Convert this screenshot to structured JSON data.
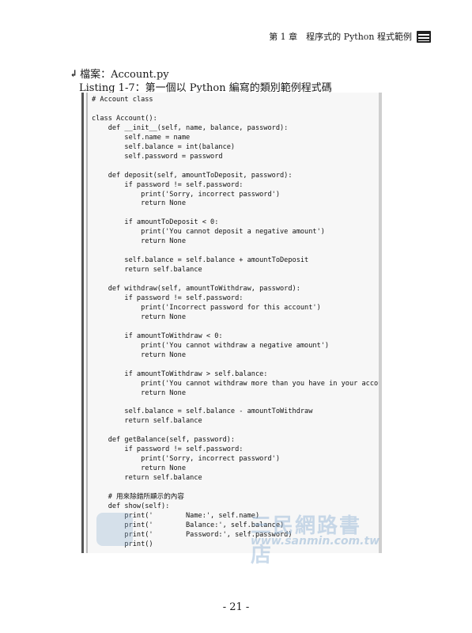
{
  "header": {
    "chapter_title": "第 1 章　程序式的 Python 程式範例",
    "icon": "book-icon"
  },
  "file_label": "檔案：Account.py",
  "listing_caption": "Listing 1-7：第一個以 Python 編寫的類別範例程式碼",
  "code": "# Account class\n\nclass Account():\n    def __init__(self, name, balance, password):\n        self.name = name\n        self.balance = int(balance)\n        self.password = password\n\n    def deposit(self, amountToDeposit, password):\n        if password != self.password:\n            print('Sorry, incorrect password')\n            return None\n\n        if amountToDeposit < 0:\n            print('You cannot deposit a negative amount')\n            return None\n\n        self.balance = self.balance + amountToDeposit\n        return self.balance\n\n    def withdraw(self, amountToWithdraw, password):\n        if password != self.password:\n            print('Incorrect password for this account')\n            return None\n\n        if amountToWithdraw < 0:\n            print('You cannot withdraw a negative amount')\n            return None\n\n        if amountToWithdraw > self.balance:\n            print('You cannot withdraw more than you have in your account')\n            return None\n\n        self.balance = self.balance - amountToWithdraw\n        return self.balance\n\n    def getBalance(self, password):\n        if password != self.password:\n            print('Sorry, incorrect password')\n            return None\n        return self.balance\n\n    # 用來除錯所顯示的內容\n    def show(self):\n        print('        Name:', self.name)\n        print('        Balance:', self.balance)\n        print('        Password:', self.password)\n        print()",
  "watermark": {
    "name": "三民網路書店",
    "url": "www.sanmin.com.tw"
  },
  "page_number": "- 21 -"
}
